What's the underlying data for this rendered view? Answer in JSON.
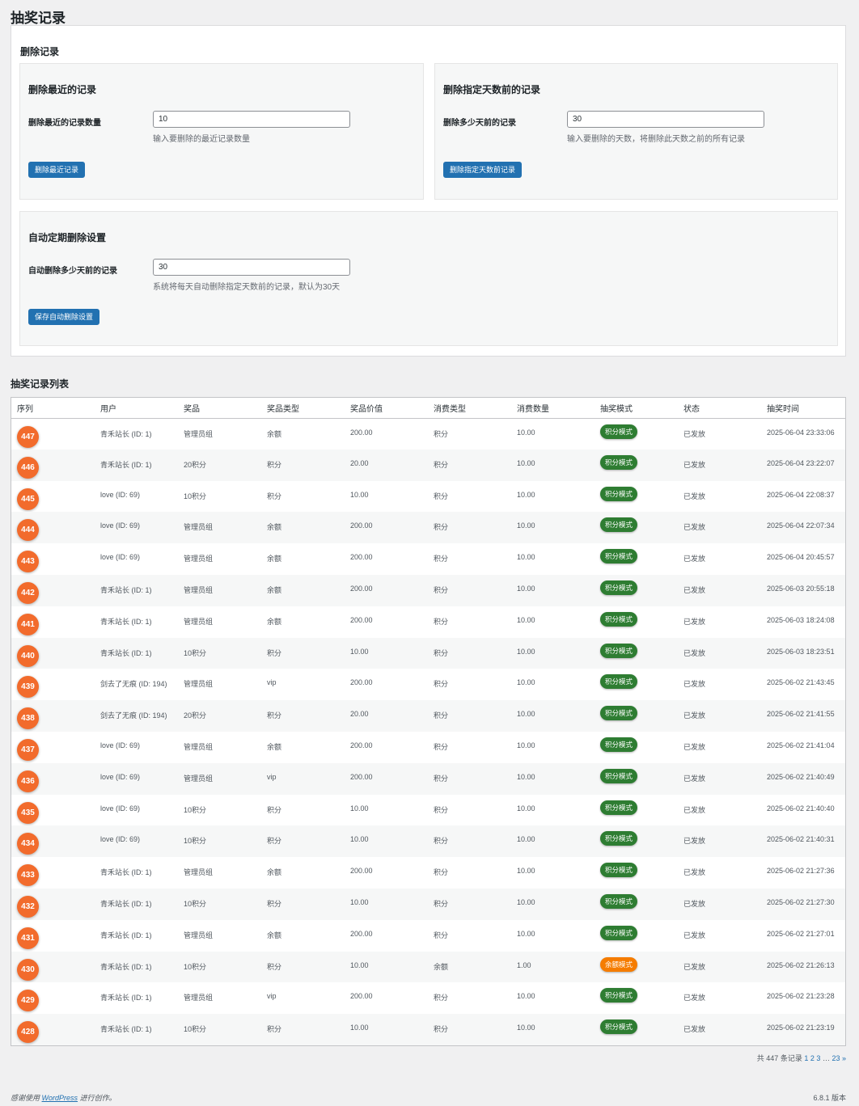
{
  "page_title": "抽奖记录",
  "delete_section": {
    "title": "删除记录",
    "recent": {
      "title": "删除最近的记录",
      "label": "删除最近的记录数量",
      "value": "10",
      "hint": "输入要删除的最近记录数量",
      "button": "删除最近记录"
    },
    "days": {
      "title": "删除指定天数前的记录",
      "label": "删除多少天前的记录",
      "value": "30",
      "hint": "输入要删除的天数，将删除此天数之前的所有记录",
      "button": "删除指定天数前记录"
    },
    "auto": {
      "title": "自动定期删除设置",
      "label": "自动删除多少天前的记录",
      "value": "30",
      "hint": "系统将每天自动删除指定天数前的记录，默认为30天",
      "button": "保存自动删除设置"
    }
  },
  "list": {
    "title": "抽奖记录列表",
    "columns": [
      "序列",
      "用户",
      "奖品",
      "奖品类型",
      "奖品价值",
      "消费类型",
      "消费数量",
      "抽奖模式",
      "状态",
      "抽奖时间"
    ],
    "rows": [
      {
        "id": "447",
        "user": "青禾站长 (ID: 1)",
        "prize": "管理员组",
        "prize_type": "余额",
        "value": "200.00",
        "cost_type": "积分",
        "cost": "10.00",
        "mode": "积分模式",
        "mode_color": "#2e7d32",
        "status": "已发放",
        "time": "2025-06-04 23:33:06"
      },
      {
        "id": "446",
        "user": "青禾站长 (ID: 1)",
        "prize": "20积分",
        "prize_type": "积分",
        "value": "20.00",
        "cost_type": "积分",
        "cost": "10.00",
        "mode": "积分模式",
        "mode_color": "#2e7d32",
        "status": "已发放",
        "time": "2025-06-04 23:22:07"
      },
      {
        "id": "445",
        "user": "love (ID: 69)",
        "prize": "10积分",
        "prize_type": "积分",
        "value": "10.00",
        "cost_type": "积分",
        "cost": "10.00",
        "mode": "积分模式",
        "mode_color": "#2e7d32",
        "status": "已发放",
        "time": "2025-06-04 22:08:37"
      },
      {
        "id": "444",
        "user": "love (ID: 69)",
        "prize": "管理员组",
        "prize_type": "余额",
        "value": "200.00",
        "cost_type": "积分",
        "cost": "10.00",
        "mode": "积分模式",
        "mode_color": "#2e7d32",
        "status": "已发放",
        "time": "2025-06-04 22:07:34"
      },
      {
        "id": "443",
        "user": "love (ID: 69)",
        "prize": "管理员组",
        "prize_type": "余额",
        "value": "200.00",
        "cost_type": "积分",
        "cost": "10.00",
        "mode": "积分模式",
        "mode_color": "#2e7d32",
        "status": "已发放",
        "time": "2025-06-04 20:45:57"
      },
      {
        "id": "442",
        "user": "青禾站长 (ID: 1)",
        "prize": "管理员组",
        "prize_type": "余额",
        "value": "200.00",
        "cost_type": "积分",
        "cost": "10.00",
        "mode": "积分模式",
        "mode_color": "#2e7d32",
        "status": "已发放",
        "time": "2025-06-03 20:55:18"
      },
      {
        "id": "441",
        "user": "青禾站长 (ID: 1)",
        "prize": "管理员组",
        "prize_type": "余额",
        "value": "200.00",
        "cost_type": "积分",
        "cost": "10.00",
        "mode": "积分模式",
        "mode_color": "#2e7d32",
        "status": "已发放",
        "time": "2025-06-03 18:24:08"
      },
      {
        "id": "440",
        "user": "青禾站长 (ID: 1)",
        "prize": "10积分",
        "prize_type": "积分",
        "value": "10.00",
        "cost_type": "积分",
        "cost": "10.00",
        "mode": "积分模式",
        "mode_color": "#2e7d32",
        "status": "已发放",
        "time": "2025-06-03 18:23:51"
      },
      {
        "id": "439",
        "user": "剑去了无痕 (ID: 194)",
        "prize": "管理员组",
        "prize_type": "vip",
        "value": "200.00",
        "cost_type": "积分",
        "cost": "10.00",
        "mode": "积分模式",
        "mode_color": "#2e7d32",
        "status": "已发放",
        "time": "2025-06-02 21:43:45"
      },
      {
        "id": "438",
        "user": "剑去了无痕 (ID: 194)",
        "prize": "20积分",
        "prize_type": "积分",
        "value": "20.00",
        "cost_type": "积分",
        "cost": "10.00",
        "mode": "积分模式",
        "mode_color": "#2e7d32",
        "status": "已发放",
        "time": "2025-06-02 21:41:55"
      },
      {
        "id": "437",
        "user": "love (ID: 69)",
        "prize": "管理员组",
        "prize_type": "余额",
        "value": "200.00",
        "cost_type": "积分",
        "cost": "10.00",
        "mode": "积分模式",
        "mode_color": "#2e7d32",
        "status": "已发放",
        "time": "2025-06-02 21:41:04"
      },
      {
        "id": "436",
        "user": "love (ID: 69)",
        "prize": "管理员组",
        "prize_type": "vip",
        "value": "200.00",
        "cost_type": "积分",
        "cost": "10.00",
        "mode": "积分模式",
        "mode_color": "#2e7d32",
        "status": "已发放",
        "time": "2025-06-02 21:40:49"
      },
      {
        "id": "435",
        "user": "love (ID: 69)",
        "prize": "10积分",
        "prize_type": "积分",
        "value": "10.00",
        "cost_type": "积分",
        "cost": "10.00",
        "mode": "积分模式",
        "mode_color": "#2e7d32",
        "status": "已发放",
        "time": "2025-06-02 21:40:40"
      },
      {
        "id": "434",
        "user": "love (ID: 69)",
        "prize": "10积分",
        "prize_type": "积分",
        "value": "10.00",
        "cost_type": "积分",
        "cost": "10.00",
        "mode": "积分模式",
        "mode_color": "#2e7d32",
        "status": "已发放",
        "time": "2025-06-02 21:40:31"
      },
      {
        "id": "433",
        "user": "青禾站长 (ID: 1)",
        "prize": "管理员组",
        "prize_type": "余额",
        "value": "200.00",
        "cost_type": "积分",
        "cost": "10.00",
        "mode": "积分模式",
        "mode_color": "#2e7d32",
        "status": "已发放",
        "time": "2025-06-02 21:27:36"
      },
      {
        "id": "432",
        "user": "青禾站长 (ID: 1)",
        "prize": "10积分",
        "prize_type": "积分",
        "value": "10.00",
        "cost_type": "积分",
        "cost": "10.00",
        "mode": "积分模式",
        "mode_color": "#2e7d32",
        "status": "已发放",
        "time": "2025-06-02 21:27:30"
      },
      {
        "id": "431",
        "user": "青禾站长 (ID: 1)",
        "prize": "管理员组",
        "prize_type": "余额",
        "value": "200.00",
        "cost_type": "积分",
        "cost": "10.00",
        "mode": "积分模式",
        "mode_color": "#2e7d32",
        "status": "已发放",
        "time": "2025-06-02 21:27:01"
      },
      {
        "id": "430",
        "user": "青禾站长 (ID: 1)",
        "prize": "10积分",
        "prize_type": "积分",
        "value": "10.00",
        "cost_type": "余额",
        "cost": "1.00",
        "mode": "余额模式",
        "mode_color": "#f57c00",
        "status": "已发放",
        "time": "2025-06-02 21:26:13"
      },
      {
        "id": "429",
        "user": "青禾站长 (ID: 1)",
        "prize": "管理员组",
        "prize_type": "vip",
        "value": "200.00",
        "cost_type": "积分",
        "cost": "10.00",
        "mode": "积分模式",
        "mode_color": "#2e7d32",
        "status": "已发放",
        "time": "2025-06-02 21:23:28"
      },
      {
        "id": "428",
        "user": "青禾站长 (ID: 1)",
        "prize": "10积分",
        "prize_type": "积分",
        "value": "10.00",
        "cost_type": "积分",
        "cost": "10.00",
        "mode": "积分模式",
        "mode_color": "#2e7d32",
        "status": "已发放",
        "time": "2025-06-02 21:23:19"
      }
    ]
  },
  "pagination": {
    "total": "共 447 条记录",
    "pages": [
      "1",
      "2",
      "3"
    ],
    "ellipsis": "…",
    "last": "23",
    "next": "»"
  },
  "footer": {
    "thanks_prefix": "感谢使用",
    "wordpress": "WordPress",
    "thanks_suffix": "进行创作。",
    "version": "6.8.1 版本"
  }
}
